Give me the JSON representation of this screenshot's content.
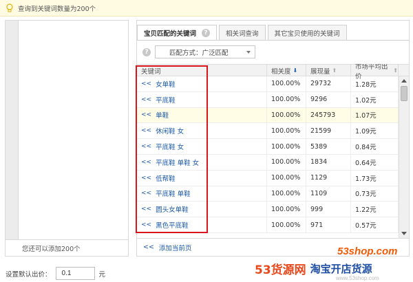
{
  "notice": {
    "text": "查询到关键词数量为200个"
  },
  "left_panel": {
    "footer": "您还可以添加200个"
  },
  "tabs": [
    {
      "label": "宝贝匹配的关键词",
      "active": true
    },
    {
      "label": "相关词查询",
      "active": false
    },
    {
      "label": "其它宝贝使用的关键词",
      "active": false
    }
  ],
  "match": {
    "label": "匹配方式：",
    "value": "广泛匹配"
  },
  "table": {
    "headers": {
      "keyword": "关键词",
      "relevance": "相关度",
      "impressions": "展现量",
      "avg_bid": "市场平均出价"
    },
    "rows": [
      {
        "prefix": "<<",
        "keyword": "女单鞋",
        "relevance": "100.00%",
        "impressions": "29732",
        "avg_bid": "1.28元"
      },
      {
        "prefix": "<<",
        "keyword": "平底鞋",
        "relevance": "100.00%",
        "impressions": "9296",
        "avg_bid": "1.02元"
      },
      {
        "prefix": "<<",
        "keyword": "单鞋",
        "relevance": "100.00%",
        "impressions": "245793",
        "avg_bid": "1.07元",
        "highlight": true
      },
      {
        "prefix": "<<",
        "keyword": "休闲鞋 女",
        "relevance": "100.00%",
        "impressions": "21599",
        "avg_bid": "1.09元"
      },
      {
        "prefix": "<<",
        "keyword": "平底鞋 女",
        "relevance": "100.00%",
        "impressions": "5389",
        "avg_bid": "0.84元"
      },
      {
        "prefix": "<<",
        "keyword": "平底鞋 单鞋 女",
        "relevance": "100.00%",
        "impressions": "1834",
        "avg_bid": "0.64元"
      },
      {
        "prefix": "<<",
        "keyword": "低帮鞋",
        "relevance": "100.00%",
        "impressions": "1129",
        "avg_bid": "1.73元"
      },
      {
        "prefix": "<<",
        "keyword": "平底鞋 单鞋",
        "relevance": "100.00%",
        "impressions": "1109",
        "avg_bid": "0.73元"
      },
      {
        "prefix": "<<",
        "keyword": "圆头女单鞋",
        "relevance": "100.00%",
        "impressions": "999",
        "avg_bid": "1.22元"
      },
      {
        "prefix": "<<",
        "keyword": "黑色平底鞋",
        "relevance": "100.00%",
        "impressions": "971",
        "avg_bid": "0.57元"
      }
    ]
  },
  "add_page": {
    "prefix": "<<",
    "label": "添加当前页"
  },
  "default_bid": {
    "label": "设置默认出价：",
    "value": "0.1",
    "unit": "元"
  },
  "watermark": {
    "site": "53shop.com",
    "brand_a": "53货源网",
    "brand_b": "淘宝开店货源",
    "url": "www.53shop.com"
  },
  "colors": {
    "link": "#1c5aa6",
    "highlight_box": "#d9141b",
    "notice_bg": "#fffbe3",
    "row_highlight": "#fffde6"
  }
}
